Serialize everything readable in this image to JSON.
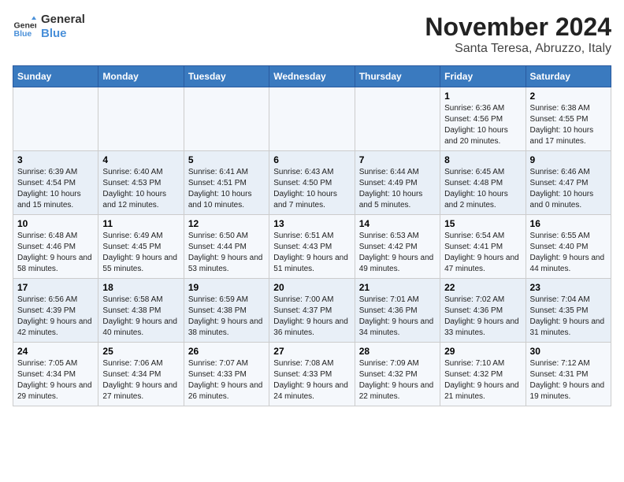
{
  "logo": {
    "line1": "General",
    "line2": "Blue"
  },
  "title": "November 2024",
  "location": "Santa Teresa, Abruzzo, Italy",
  "days_of_week": [
    "Sunday",
    "Monday",
    "Tuesday",
    "Wednesday",
    "Thursday",
    "Friday",
    "Saturday"
  ],
  "weeks": [
    [
      {
        "day": "",
        "info": ""
      },
      {
        "day": "",
        "info": ""
      },
      {
        "day": "",
        "info": ""
      },
      {
        "day": "",
        "info": ""
      },
      {
        "day": "",
        "info": ""
      },
      {
        "day": "1",
        "info": "Sunrise: 6:36 AM\nSunset: 4:56 PM\nDaylight: 10 hours and 20 minutes."
      },
      {
        "day": "2",
        "info": "Sunrise: 6:38 AM\nSunset: 4:55 PM\nDaylight: 10 hours and 17 minutes."
      }
    ],
    [
      {
        "day": "3",
        "info": "Sunrise: 6:39 AM\nSunset: 4:54 PM\nDaylight: 10 hours and 15 minutes."
      },
      {
        "day": "4",
        "info": "Sunrise: 6:40 AM\nSunset: 4:53 PM\nDaylight: 10 hours and 12 minutes."
      },
      {
        "day": "5",
        "info": "Sunrise: 6:41 AM\nSunset: 4:51 PM\nDaylight: 10 hours and 10 minutes."
      },
      {
        "day": "6",
        "info": "Sunrise: 6:43 AM\nSunset: 4:50 PM\nDaylight: 10 hours and 7 minutes."
      },
      {
        "day": "7",
        "info": "Sunrise: 6:44 AM\nSunset: 4:49 PM\nDaylight: 10 hours and 5 minutes."
      },
      {
        "day": "8",
        "info": "Sunrise: 6:45 AM\nSunset: 4:48 PM\nDaylight: 10 hours and 2 minutes."
      },
      {
        "day": "9",
        "info": "Sunrise: 6:46 AM\nSunset: 4:47 PM\nDaylight: 10 hours and 0 minutes."
      }
    ],
    [
      {
        "day": "10",
        "info": "Sunrise: 6:48 AM\nSunset: 4:46 PM\nDaylight: 9 hours and 58 minutes."
      },
      {
        "day": "11",
        "info": "Sunrise: 6:49 AM\nSunset: 4:45 PM\nDaylight: 9 hours and 55 minutes."
      },
      {
        "day": "12",
        "info": "Sunrise: 6:50 AM\nSunset: 4:44 PM\nDaylight: 9 hours and 53 minutes."
      },
      {
        "day": "13",
        "info": "Sunrise: 6:51 AM\nSunset: 4:43 PM\nDaylight: 9 hours and 51 minutes."
      },
      {
        "day": "14",
        "info": "Sunrise: 6:53 AM\nSunset: 4:42 PM\nDaylight: 9 hours and 49 minutes."
      },
      {
        "day": "15",
        "info": "Sunrise: 6:54 AM\nSunset: 4:41 PM\nDaylight: 9 hours and 47 minutes."
      },
      {
        "day": "16",
        "info": "Sunrise: 6:55 AM\nSunset: 4:40 PM\nDaylight: 9 hours and 44 minutes."
      }
    ],
    [
      {
        "day": "17",
        "info": "Sunrise: 6:56 AM\nSunset: 4:39 PM\nDaylight: 9 hours and 42 minutes."
      },
      {
        "day": "18",
        "info": "Sunrise: 6:58 AM\nSunset: 4:38 PM\nDaylight: 9 hours and 40 minutes."
      },
      {
        "day": "19",
        "info": "Sunrise: 6:59 AM\nSunset: 4:38 PM\nDaylight: 9 hours and 38 minutes."
      },
      {
        "day": "20",
        "info": "Sunrise: 7:00 AM\nSunset: 4:37 PM\nDaylight: 9 hours and 36 minutes."
      },
      {
        "day": "21",
        "info": "Sunrise: 7:01 AM\nSunset: 4:36 PM\nDaylight: 9 hours and 34 minutes."
      },
      {
        "day": "22",
        "info": "Sunrise: 7:02 AM\nSunset: 4:36 PM\nDaylight: 9 hours and 33 minutes."
      },
      {
        "day": "23",
        "info": "Sunrise: 7:04 AM\nSunset: 4:35 PM\nDaylight: 9 hours and 31 minutes."
      }
    ],
    [
      {
        "day": "24",
        "info": "Sunrise: 7:05 AM\nSunset: 4:34 PM\nDaylight: 9 hours and 29 minutes."
      },
      {
        "day": "25",
        "info": "Sunrise: 7:06 AM\nSunset: 4:34 PM\nDaylight: 9 hours and 27 minutes."
      },
      {
        "day": "26",
        "info": "Sunrise: 7:07 AM\nSunset: 4:33 PM\nDaylight: 9 hours and 26 minutes."
      },
      {
        "day": "27",
        "info": "Sunrise: 7:08 AM\nSunset: 4:33 PM\nDaylight: 9 hours and 24 minutes."
      },
      {
        "day": "28",
        "info": "Sunrise: 7:09 AM\nSunset: 4:32 PM\nDaylight: 9 hours and 22 minutes."
      },
      {
        "day": "29",
        "info": "Sunrise: 7:10 AM\nSunset: 4:32 PM\nDaylight: 9 hours and 21 minutes."
      },
      {
        "day": "30",
        "info": "Sunrise: 7:12 AM\nSunset: 4:31 PM\nDaylight: 9 hours and 19 minutes."
      }
    ]
  ]
}
